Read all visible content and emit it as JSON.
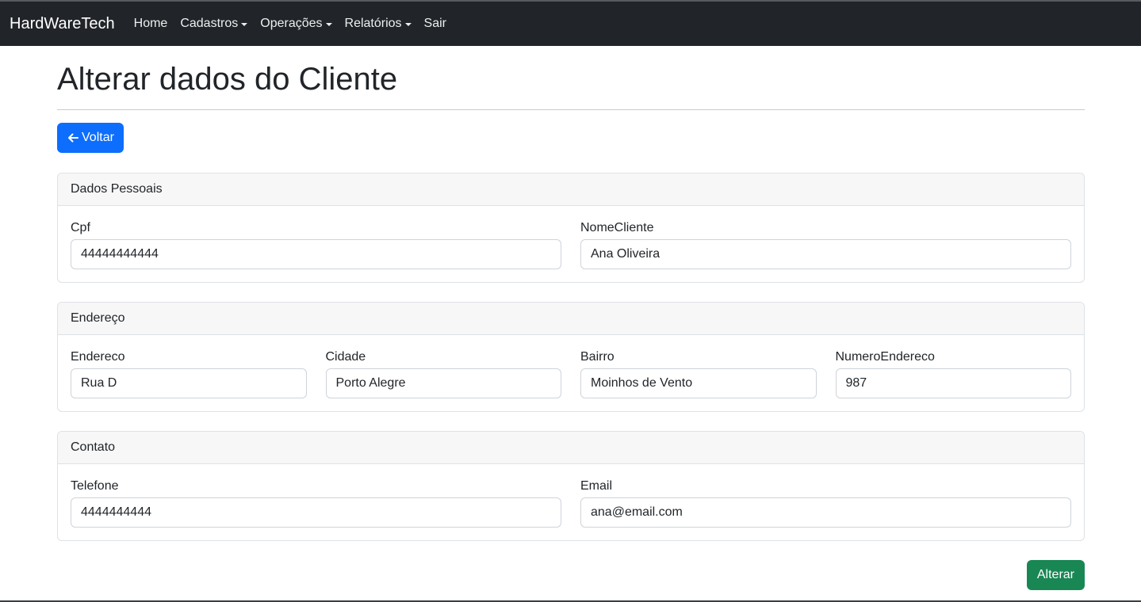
{
  "navbar": {
    "brand": "HardWareTech",
    "items": [
      {
        "label": "Home"
      },
      {
        "label": "Cadastros"
      },
      {
        "label": "Operações"
      },
      {
        "label": "Relatórios"
      },
      {
        "label": "Sair"
      }
    ]
  },
  "page": {
    "title": "Alterar dados do Cliente",
    "back_label": "Voltar",
    "submit_label": "Alterar"
  },
  "sections": {
    "personal": {
      "title": "Dados Pessoais",
      "cpf_label": "Cpf",
      "cpf_value": "44444444444",
      "nome_label": "NomeCliente",
      "nome_value": "Ana Oliveira"
    },
    "address": {
      "title": "Endereço",
      "endereco_label": "Endereco",
      "endereco_value": "Rua D",
      "cidade_label": "Cidade",
      "cidade_value": "Porto Alegre",
      "bairro_label": "Bairro",
      "bairro_value": "Moinhos de Vento",
      "numero_label": "NumeroEndereco",
      "numero_value": "987"
    },
    "contact": {
      "title": "Contato",
      "telefone_label": "Telefone",
      "telefone_value": "4444444444",
      "email_label": "Email",
      "email_value": "ana@email.com"
    }
  },
  "colors": {
    "navbar_bg": "#212529",
    "primary": "#0d6efd",
    "success": "#198754"
  },
  "icons": {
    "back": "arrow-left-icon",
    "dropdown": "caret-down-icon"
  }
}
